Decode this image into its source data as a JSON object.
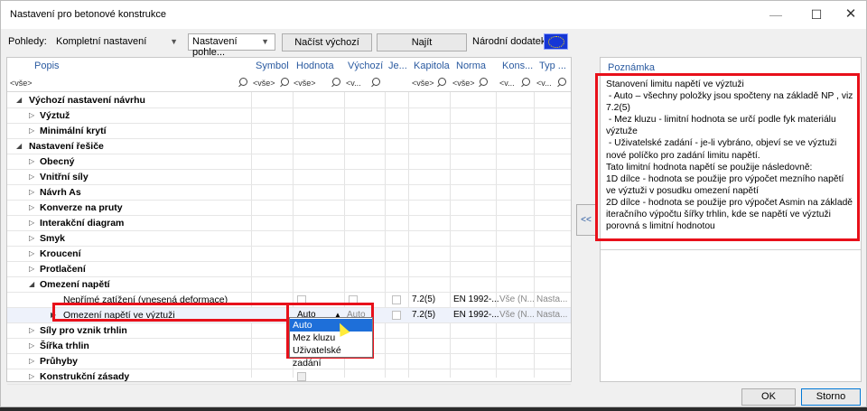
{
  "window": {
    "title": "Nastavení pro betonové konstrukce",
    "minimize": "—",
    "maximize": "☐",
    "close": "✕"
  },
  "toolbar": {
    "views_label": "Pohledy:",
    "views_value": "Kompletní nastavení",
    "view_settings": "Nastavení pohle...",
    "load_default": "Načíst výchozí",
    "find": "Najít",
    "national_annex_label": "Národní dodatek:"
  },
  "grid": {
    "columns": {
      "popis": "Popis",
      "symbol": "Symbol",
      "hodnota": "Hodnota",
      "vychozi": "Výchozí",
      "je": "Je...",
      "kapitola": "Kapitola",
      "norma": "Norma",
      "kons": "Kons...",
      "typ": "Typ ..."
    },
    "filters": {
      "popis": "<vše>",
      "symbol": "<vše>",
      "hodnota": "<vše>",
      "vychozi": "<v...",
      "kapitola": "<vše>",
      "norma": "<vše>",
      "kons": "<v...",
      "typ": "<v..."
    },
    "rows": [
      {
        "label": "Výchozí nastavení návrhu",
        "arrow": "◢"
      },
      {
        "label": "Výztuž",
        "arrow": "▷"
      },
      {
        "label": "Minimální krytí",
        "arrow": "▷"
      },
      {
        "label": "Nastavení řešiče",
        "arrow": "◢"
      },
      {
        "label": "Obecný",
        "arrow": "▷"
      },
      {
        "label": "Vnitřní síly",
        "arrow": "▷"
      },
      {
        "label": "Návrh As",
        "arrow": "▷"
      },
      {
        "label": "Konverze na pruty",
        "arrow": "▷"
      },
      {
        "label": "Interakční diagram",
        "arrow": "▷"
      },
      {
        "label": "Smyk",
        "arrow": "▷"
      },
      {
        "label": "Kroucení",
        "arrow": "▷"
      },
      {
        "label": "Protlačení",
        "arrow": "▷"
      },
      {
        "label": "Omezení napětí",
        "arrow": "◢"
      },
      {
        "label": "Nepřímé zatížení (vnesená deformace)",
        "arrow": ""
      },
      {
        "label": "Omezení napětí ve výztuži",
        "arrow": "▶"
      },
      {
        "label": "Síly pro vznik trhlin",
        "arrow": "▷"
      },
      {
        "label": "Šířka trhlin",
        "arrow": "▷"
      },
      {
        "label": "Průhyby",
        "arrow": "▷"
      },
      {
        "label": "Konstrukční zásady",
        "arrow": "▷"
      }
    ],
    "row13": {
      "kapitola": "7.2(5)",
      "norma": "EN 1992-...",
      "kons": "Vše (N...",
      "typ": "Nasta..."
    },
    "row14": {
      "hodnota": "Auto",
      "vychozi": "Auto",
      "kapitola": "7.2(5)",
      "norma": "EN 1992-...",
      "kons": "Vše (N...",
      "typ": "Nasta..."
    },
    "dropdown": [
      "Auto",
      "Mez kluzu",
      "Uživatelské zadání"
    ]
  },
  "collapse": "<<",
  "note": {
    "header": "Poznámka",
    "text": "Stanovení limitu napětí ve výztuži\n - Auto – všechny položky jsou spočteny na základě NP , viz 7.2(5)\n - Mez kluzu - limitní hodnota se určí podle fyk materiálu výztuže\n - Uživatelské zadání - je-li vybráno, objeví se ve výztuži nové políčko pro zadání limitu napětí.\nTato limitní hodnota napětí se použije následovně:\n1D dílce - hodnota se použije pro výpočet mezního napětí ve výztuži v posudku omezení napětí\n2D dílce - hodnota se použije pro výpočet Asmin na základě iteračního výpočtu šířky trhlin, kde se napětí ve výztuži porovná s limitní hodnotou"
  },
  "buttons": {
    "ok": "OK",
    "cancel": "Storno"
  }
}
